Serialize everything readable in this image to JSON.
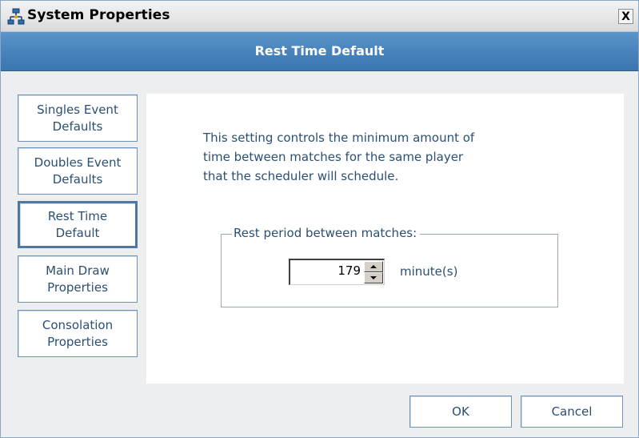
{
  "window": {
    "title": "System Properties",
    "close_label": "X"
  },
  "header": {
    "title": "Rest Time Default"
  },
  "nav": {
    "items": [
      {
        "label": "Singles Event\nDefaults"
      },
      {
        "label": "Doubles Event\nDefaults"
      },
      {
        "label": "Rest Time\nDefault",
        "active": true
      },
      {
        "label": "Main Draw\nProperties"
      },
      {
        "label": "Consolation\nProperties"
      }
    ]
  },
  "content": {
    "description": "This setting controls the minimum amount of\ntime between matches for the same player\nthat the scheduler will schedule.",
    "group_label": "Rest period between matches:",
    "rest_value": "179",
    "unit": "minute(s)"
  },
  "buttons": {
    "ok": "OK",
    "cancel": "Cancel"
  },
  "colors": {
    "header_band": "#4a86bd",
    "text": "#2b4f73",
    "button_border": "#6f93b8"
  }
}
